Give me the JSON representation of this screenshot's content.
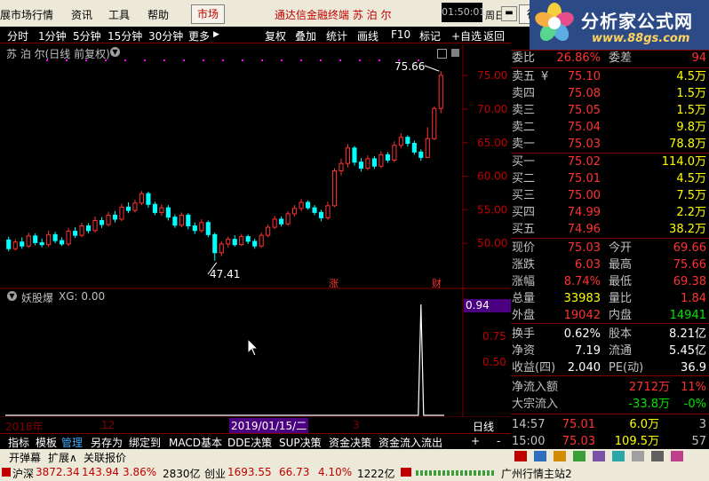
{
  "menu": {
    "items": [
      "展市场行情",
      "资讯",
      "工具",
      "帮助"
    ],
    "market_tab": "市场",
    "title": "通达信金融终端  苏 泊 尔",
    "clock": "01:50:01",
    "weekday": "周日",
    "trade_button": "行"
  },
  "logo": {
    "main": "分析家公式网",
    "url": "www.88gs.com"
  },
  "toolbar": {
    "periods": [
      "分时",
      "1分钟",
      "5分钟",
      "15分钟",
      "30分钟",
      "更多"
    ],
    "tools": [
      "复权",
      "叠加",
      "统计",
      "画线",
      "F10",
      "标记",
      "+自选",
      "返回"
    ]
  },
  "chart": {
    "title": "苏 泊 尔(日线 前复权)",
    "high_label": "75.66",
    "low_label": "47.41",
    "event_marks": [
      "涨",
      "财"
    ],
    "yaxis": [
      "75.00",
      "70.00",
      "65.00",
      "60.00",
      "55.00",
      "50.00"
    ],
    "indicator_title": "妖股爆",
    "indicator_value": "XG: 0.00",
    "indicator_last": "0.94",
    "indicator_yaxis": [
      "0.75",
      "0.50"
    ],
    "xaxis": [
      "2018年",
      "12",
      "2019/01/15/二",
      "3"
    ],
    "period": "日线"
  },
  "chart_data": {
    "type": "candlestick",
    "title": "苏 泊 尔(日线 前复权)",
    "ylim": [
      45,
      77
    ],
    "candles": [
      [
        50.5,
        49.2,
        51.0,
        48.8
      ],
      [
        49.2,
        50.2,
        50.6,
        48.9
      ],
      [
        50.2,
        49.6,
        50.9,
        49.2
      ],
      [
        49.6,
        51.1,
        51.6,
        49.3
      ],
      [
        51.1,
        50.1,
        51.5,
        49.7
      ],
      [
        50.1,
        49.8,
        50.7,
        49.4
      ],
      [
        49.8,
        51.3,
        51.9,
        49.5
      ],
      [
        51.3,
        50.4,
        51.7,
        50.0
      ],
      [
        50.4,
        49.9,
        50.9,
        49.6
      ],
      [
        49.9,
        51.8,
        52.3,
        49.6
      ],
      [
        51.8,
        51.2,
        52.4,
        50.8
      ],
      [
        51.2,
        52.6,
        53.1,
        50.9
      ],
      [
        52.6,
        51.9,
        53.0,
        51.5
      ],
      [
        51.9,
        53.4,
        54.0,
        51.6
      ],
      [
        53.4,
        52.8,
        53.9,
        52.3
      ],
      [
        52.8,
        54.2,
        54.7,
        52.5
      ],
      [
        54.2,
        53.6,
        54.8,
        53.1
      ],
      [
        53.6,
        55.4,
        55.9,
        53.3
      ],
      [
        55.4,
        54.9,
        56.1,
        54.5
      ],
      [
        54.9,
        56.0,
        56.5,
        54.6
      ],
      [
        56.0,
        57.4,
        57.8,
        55.7
      ],
      [
        57.4,
        55.8,
        57.7,
        55.3
      ],
      [
        55.8,
        54.6,
        56.2,
        54.2
      ],
      [
        54.6,
        55.3,
        55.8,
        54.1
      ],
      [
        55.3,
        53.9,
        55.7,
        53.4
      ],
      [
        53.9,
        52.7,
        54.3,
        52.3
      ],
      [
        52.7,
        54.2,
        54.6,
        52.4
      ],
      [
        54.2,
        52.6,
        54.5,
        52.1
      ],
      [
        52.6,
        51.9,
        53.1,
        51.4
      ],
      [
        51.9,
        53.1,
        53.6,
        51.6
      ],
      [
        53.1,
        51.3,
        53.4,
        50.9
      ],
      [
        51.3,
        48.6,
        51.6,
        47.41
      ],
      [
        48.6,
        49.9,
        50.3,
        48.1
      ],
      [
        49.9,
        50.6,
        51.0,
        49.4
      ],
      [
        50.6,
        49.8,
        51.2,
        49.5
      ],
      [
        49.8,
        51.0,
        51.4,
        49.6
      ],
      [
        51.0,
        50.3,
        51.3,
        49.9
      ],
      [
        50.3,
        49.6,
        50.7,
        49.2
      ],
      [
        49.6,
        51.2,
        51.6,
        49.3
      ],
      [
        51.2,
        52.4,
        52.8,
        50.9
      ],
      [
        52.4,
        53.6,
        54.1,
        52.1
      ],
      [
        53.6,
        52.9,
        54.0,
        52.5
      ],
      [
        52.9,
        54.4,
        54.8,
        52.6
      ],
      [
        54.4,
        55.2,
        55.7,
        54.0
      ],
      [
        55.2,
        56.1,
        56.6,
        54.8
      ],
      [
        56.1,
        55.3,
        56.4,
        55.0
      ],
      [
        55.3,
        54.6,
        55.7,
        54.2
      ],
      [
        54.6,
        53.8,
        55.0,
        53.3
      ],
      [
        53.8,
        55.6,
        56.2,
        53.5
      ],
      [
        55.6,
        60.8,
        61.2,
        55.4
      ],
      [
        60.8,
        61.9,
        62.6,
        60.1
      ],
      [
        61.9,
        64.2,
        64.8,
        61.3
      ],
      [
        64.2,
        62.1,
        64.5,
        61.6
      ],
      [
        62.1,
        61.2,
        62.7,
        60.7
      ],
      [
        61.2,
        62.6,
        63.1,
        60.9
      ],
      [
        62.6,
        61.5,
        63.0,
        61.1
      ],
      [
        61.5,
        63.2,
        63.7,
        61.2
      ],
      [
        63.2,
        62.4,
        63.6,
        62.0
      ],
      [
        62.4,
        64.6,
        65.2,
        62.1
      ],
      [
        64.6,
        65.8,
        66.4,
        64.2
      ],
      [
        65.8,
        64.9,
        66.1,
        64.4
      ],
      [
        64.9,
        63.6,
        65.3,
        63.2
      ],
      [
        63.6,
        62.8,
        64.0,
        62.3
      ],
      [
        62.8,
        65.6,
        67.3,
        64.6
      ],
      [
        65.6,
        70.1,
        70.4,
        65.4
      ],
      [
        70.1,
        75.03,
        75.66,
        69.38
      ]
    ],
    "indicator": {
      "name": "妖股爆",
      "signal_index": 62,
      "signal_value": 0.94,
      "ylim": [
        0,
        1.0
      ]
    }
  },
  "quote": {
    "weibi": {
      "label": "委比",
      "value": "26.86%",
      "label2": "委差",
      "value2": "94"
    },
    "asks": [
      {
        "label": "卖五",
        "mark": "¥",
        "price": "75.10",
        "vol": "4.5万"
      },
      {
        "label": "卖四",
        "mark": "",
        "price": "75.08",
        "vol": "1.5万"
      },
      {
        "label": "卖三",
        "mark": "",
        "price": "75.05",
        "vol": "1.5万"
      },
      {
        "label": "卖二",
        "mark": "",
        "price": "75.04",
        "vol": "9.8万"
      },
      {
        "label": "卖一",
        "mark": "",
        "price": "75.03",
        "vol": "78.8万"
      }
    ],
    "bids": [
      {
        "label": "买一",
        "price": "75.02",
        "vol": "114.0万"
      },
      {
        "label": "买二",
        "price": "75.01",
        "vol": "4.5万"
      },
      {
        "label": "买三",
        "price": "75.00",
        "vol": "7.5万"
      },
      {
        "label": "买四",
        "price": "74.99",
        "vol": "2.2万"
      },
      {
        "label": "买五",
        "price": "74.96",
        "vol": "38.2万"
      }
    ],
    "stats": [
      {
        "l": "现价",
        "v": "75.03",
        "vc": "red",
        "l2": "今开",
        "v2": "69.66",
        "v2c": "red"
      },
      {
        "l": "涨跌",
        "v": "6.03",
        "vc": "red",
        "l2": "最高",
        "v2": "75.66",
        "v2c": "red"
      },
      {
        "l": "涨幅",
        "v": "8.74%",
        "vc": "red",
        "l2": "最低",
        "v2": "69.38",
        "v2c": "red"
      },
      {
        "l": "总量",
        "v": "33983",
        "vc": "yel",
        "l2": "量比",
        "v2": "1.84",
        "v2c": "red"
      },
      {
        "l": "外盘",
        "v": "19042",
        "vc": "red",
        "l2": "内盘",
        "v2": "14941",
        "v2c": "grn"
      }
    ],
    "fund": [
      {
        "l": "换手",
        "v": "0.62%",
        "l2": "股本",
        "v2": "8.21亿"
      },
      {
        "l": "净资",
        "v": "7.19",
        "l2": "流通",
        "v2": "5.45亿"
      },
      {
        "l": "收益(四)",
        "v": "2.040",
        "l2": "PE(动)",
        "v2": "36.9"
      }
    ],
    "flow": [
      {
        "l": "净流入额",
        "v": "2712万",
        "vc": "red",
        "v2": "11%",
        "v2c": "red"
      },
      {
        "l": "大宗流入",
        "v": "-33.8万",
        "vc": "grn",
        "v2": "-0%",
        "v2c": "grn"
      }
    ],
    "ticks": [
      {
        "t": "14:57",
        "p": "75.01",
        "v": "6.0万",
        "n": "3"
      },
      {
        "t": "15:00",
        "p": "75.03",
        "v": "109.5万",
        "n": "57"
      }
    ]
  },
  "bottom_tabs": [
    "指标",
    "模板",
    "管理",
    "另存为",
    "绑定到",
    "MACD基本",
    "DDE决策",
    "SUP决策",
    "资金决策",
    "资金流入流出",
    "+",
    "-"
  ],
  "bar3": [
    "开弹幕",
    "扩展∧",
    "关联报价"
  ],
  "status": {
    "sh": "沪深",
    "sh_val": "3872.34",
    "sh_chg": "143.94",
    "sh_pct": "3.86%",
    "sh_amt": "2830亿",
    "cy": "创业",
    "cy_val": "1693.55",
    "cy_chg": "66.73",
    "cy_pct": "4.10%",
    "cy_amt": "1222亿",
    "server": "广州行情主站2"
  },
  "colors": {
    "up": "#ff3232",
    "down": "#00ffff",
    "grid": "#800000",
    "panel_bg": "#000000"
  }
}
